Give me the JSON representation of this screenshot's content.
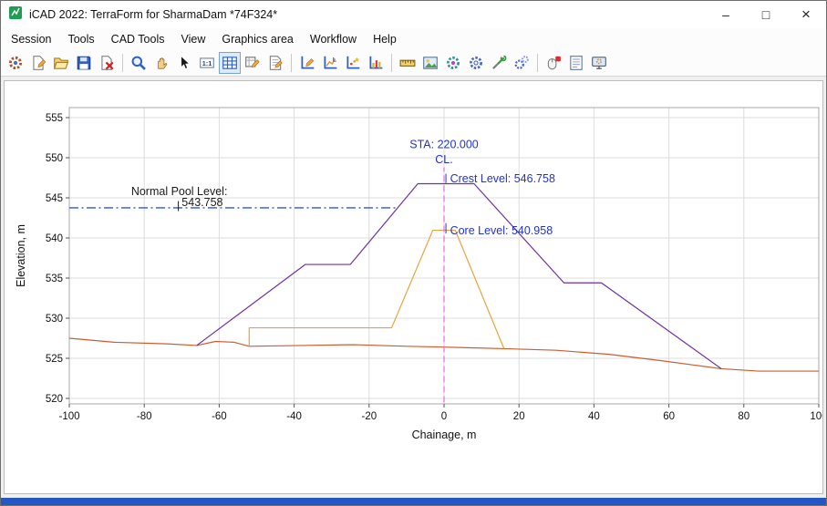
{
  "window": {
    "title": "iCAD 2022: TerraForm for SharmaDam *74F324*",
    "controls": {
      "minimize": "–",
      "maximize": "□",
      "close": "×"
    }
  },
  "menu": {
    "items": [
      "Session",
      "Tools",
      "CAD Tools",
      "View",
      "Graphics area",
      "Workflow",
      "Help"
    ]
  },
  "toolbar": {
    "active_tool": "grid",
    "groups": [
      [
        "app-settings",
        "new-drawing",
        "open-drawing",
        "save-drawing",
        "close-drawing"
      ],
      [
        "zoom",
        "pan",
        "pick",
        "actual-size",
        "grid",
        "edit-cell",
        "edit-sheet"
      ],
      [
        "chart-edit",
        "chart-labels",
        "chart-points",
        "chart-columns"
      ],
      [
        "measure-ruler",
        "image-view",
        "machine-settings",
        "settings-gear",
        "tools",
        "run-process"
      ],
      [
        "mouse-settings",
        "session-log",
        "display-settings"
      ]
    ]
  },
  "chart_data": {
    "type": "line",
    "title": "",
    "xlabel": "Chainage, m",
    "ylabel": "Elevation, m",
    "xlim": [
      -100,
      100
    ],
    "ylim": [
      520,
      555
    ],
    "xticks": [
      -100,
      -80,
      -60,
      -40,
      -20,
      0,
      20,
      40,
      60,
      80,
      100
    ],
    "yticks": [
      520,
      525,
      530,
      535,
      540,
      545,
      550,
      555
    ],
    "grid": true,
    "station": "STA: 220.000",
    "crest_level": 546.758,
    "core_level": 540.958,
    "normal_pool_level": 543.758,
    "series": [
      {
        "name": "original-ground",
        "color": "#cd5c2e",
        "style": "solid",
        "width": 1.2,
        "points": [
          [
            -100,
            527.5
          ],
          [
            -88,
            527.0
          ],
          [
            -74,
            526.8
          ],
          [
            -66,
            526.6
          ],
          [
            -61,
            527.1
          ],
          [
            -56,
            527.0
          ],
          [
            -52,
            526.5
          ],
          [
            -38,
            526.6
          ],
          [
            -24,
            526.7
          ],
          [
            -10,
            526.5
          ],
          [
            0,
            526.4
          ],
          [
            16,
            526.2
          ],
          [
            30,
            526.0
          ],
          [
            44,
            525.5
          ],
          [
            58,
            524.7
          ],
          [
            74,
            523.7
          ],
          [
            84,
            523.4
          ],
          [
            100,
            523.4
          ]
        ]
      },
      {
        "name": "embankment",
        "color": "#7030a0",
        "style": "solid",
        "width": 1.2,
        "points": [
          [
            -66,
            526.6
          ],
          [
            -37,
            536.7
          ],
          [
            -25,
            536.7
          ],
          [
            -7,
            546.758
          ],
          [
            8,
            546.758
          ],
          [
            32,
            534.4
          ],
          [
            42,
            534.4
          ],
          [
            74,
            523.7
          ]
        ]
      },
      {
        "name": "core",
        "color": "#e8a33c",
        "style": "solid",
        "width": 1.2,
        "points": [
          [
            -52,
            526.5
          ],
          [
            -52,
            528.8
          ],
          [
            -14,
            528.8
          ],
          [
            -3,
            540.958
          ],
          [
            3,
            540.958
          ],
          [
            16,
            526.2
          ]
        ]
      },
      {
        "name": "normal-pool-level",
        "color": "#2e55dd",
        "style": "dashdot",
        "width": 1.3,
        "points": [
          [
            -100,
            543.758
          ],
          [
            -12.5,
            543.758
          ]
        ]
      },
      {
        "name": "centerline",
        "color": "#ea6ce8",
        "style": "dashed",
        "width": 1.2,
        "points": [
          [
            0,
            519.5
          ],
          [
            0,
            548.8
          ]
        ]
      }
    ],
    "annotations": [
      {
        "name": "station-label",
        "text": "STA: 220.000",
        "x": 0,
        "elev": 551.2,
        "anchor": "middle",
        "color": "#2233cc"
      },
      {
        "name": "centerline-label",
        "text": "CL.",
        "x": 0,
        "elev": 549.3,
        "anchor": "middle",
        "color": "#2233cc"
      },
      {
        "name": "crest-level-label",
        "text": "Crest Level: 546.758",
        "x": 1.6,
        "elev": 546.95,
        "anchor": "start",
        "color": "#2233cc",
        "leader": {
          "x": 0.5,
          "from": 548.0,
          "to": 546.85
        }
      },
      {
        "name": "core-level-label",
        "text": "Core Level: 540.958",
        "x": 1.6,
        "elev": 540.45,
        "anchor": "start",
        "color": "#2233cc",
        "leader": {
          "x": 0.5,
          "from": 541.85,
          "to": 540.55
        }
      },
      {
        "name": "normal-pool-level-label",
        "text": "Normal Pool Level:",
        "x": -83.5,
        "elev": 545.35,
        "anchor": "start",
        "color": "#1a1a1a"
      },
      {
        "name": "normal-pool-level-value",
        "text": "543.758",
        "x": -70,
        "elev": 543.95,
        "anchor": "start",
        "color": "#1a1a1a",
        "leader": {
          "x": -70.9,
          "from": 544.6,
          "to": 543.35
        }
      }
    ]
  }
}
